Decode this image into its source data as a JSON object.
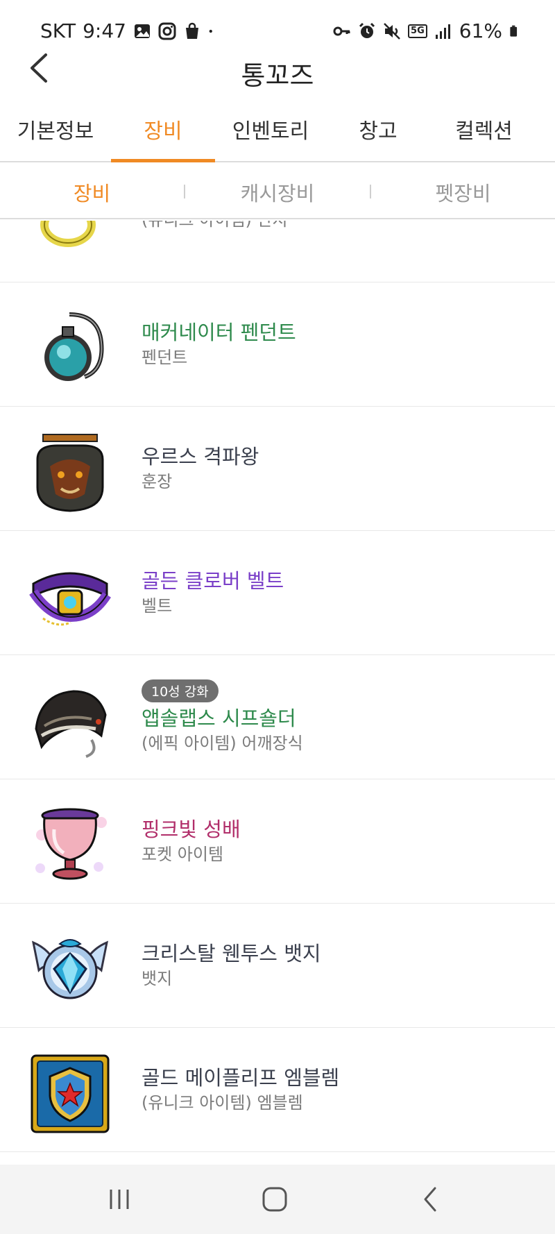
{
  "status": {
    "carrier": "SKT",
    "time": "9:47",
    "network": "5G",
    "battery": "61%"
  },
  "header": {
    "title": "통꼬즈",
    "back_icon": "chevron-left-icon"
  },
  "main_tabs": [
    {
      "label": "기본정보",
      "active": false
    },
    {
      "label": "장비",
      "active": true
    },
    {
      "label": "인벤토리",
      "active": false
    },
    {
      "label": "창고",
      "active": false
    },
    {
      "label": "컬렉션",
      "active": false
    }
  ],
  "sub_tabs": [
    {
      "label": "장비",
      "active": true
    },
    {
      "label": "캐시장비",
      "active": false
    },
    {
      "label": "펫장비",
      "active": false
    }
  ],
  "items": [
    {
      "name": "",
      "type": "(유니크 아이템) 반지",
      "badge": "",
      "name_color": "#3a3f4d",
      "icon": "ring-icon"
    },
    {
      "name": "매커네이터 펜던트",
      "type": "펜던트",
      "badge": "",
      "name_color": "#2e8a4c",
      "icon": "pendant-icon"
    },
    {
      "name": "우르스 격파왕",
      "type": "훈장",
      "badge": "",
      "name_color": "#3a3f4d",
      "icon": "medal-icon"
    },
    {
      "name": "골든 클로버 벨트",
      "type": "벨트",
      "badge": "",
      "name_color": "#7a3fc8",
      "icon": "belt-icon"
    },
    {
      "name": "앱솔랩스 시프숄더",
      "type": "(에픽 아이템) 어깨장식",
      "badge": "10성 강화",
      "name_color": "#2e8a4c",
      "icon": "shoulder-icon"
    },
    {
      "name": "핑크빛 성배",
      "type": "포켓 아이템",
      "badge": "",
      "name_color": "#b12e6a",
      "icon": "chalice-icon"
    },
    {
      "name": "크리스탈 웬투스 뱃지",
      "type": "뱃지",
      "badge": "",
      "name_color": "#3a3f4d",
      "icon": "badge-icon"
    },
    {
      "name": "골드 메이플리프 엠블렘",
      "type": "(유니크 아이템) 엠블렘",
      "badge": "",
      "name_color": "#3a3f4d",
      "icon": "emblem-icon"
    }
  ],
  "colors": {
    "accent": "#f08a24",
    "badge_bg": "#6f6f6f"
  }
}
